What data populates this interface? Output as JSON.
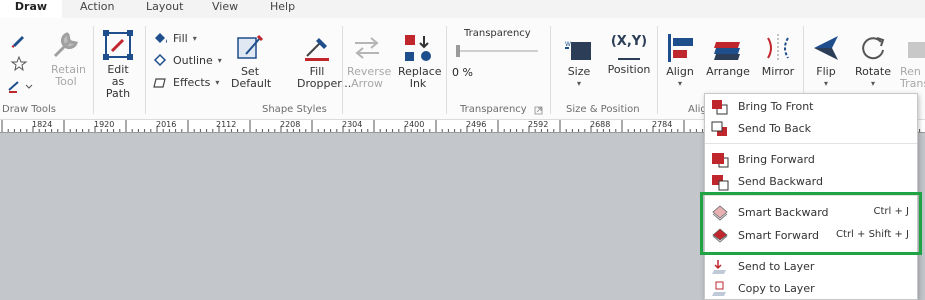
{
  "tabs": [
    "Draw",
    "Action",
    "Layout",
    "View",
    "Help"
  ],
  "draw_tools": {
    "retain_tool": "Retain Tool",
    "edit_as_path": "Edit as Path",
    "group_label": "Draw Tools"
  },
  "shape_styles": {
    "fill": "Fill",
    "outline": "Outline",
    "effects": "Effects",
    "set_default": "Set Default",
    "fill_dropper": "Fill Dropper...",
    "reverse_arrow": "Reverse Arrow",
    "replace_ink": "Replace Ink",
    "group_label": "Shape Styles"
  },
  "transparency": {
    "label": "Transparency",
    "value": "0 %",
    "group_label": "Transparency"
  },
  "size_position": {
    "size": "Size",
    "position": "Position",
    "xy_label": "(X,Y)",
    "group_label": "Size & Position"
  },
  "arrange": {
    "align": "Align",
    "arrange": "Arrange",
    "mirror": "Mirror",
    "flip": "Flip",
    "rotate": "Rotate",
    "rename_partial": "Ren Trans",
    "group_label_partial": "Alig"
  },
  "ruler_ticks": [
    "1824",
    "1920",
    "2016",
    "2112",
    "2208",
    "2304",
    "2400",
    "2496",
    "2592",
    "2688",
    "2784"
  ],
  "menu": {
    "bring_to_front": "Bring To Front",
    "send_to_back": "Send To Back",
    "bring_forward": "Bring Forward",
    "send_backward": "Send Backward",
    "smart_backward": "Smart Backward",
    "smart_backward_shortcut": "Ctrl + J",
    "smart_forward": "Smart Forward",
    "smart_forward_shortcut": "Ctrl + Shift + J",
    "send_to_layer": "Send to Layer",
    "copy_to_layer": "Copy to Layer"
  },
  "colors": {
    "highlight": "#1fa344",
    "accent_red": "#c0272d",
    "accent_blue": "#1f4e8c"
  }
}
